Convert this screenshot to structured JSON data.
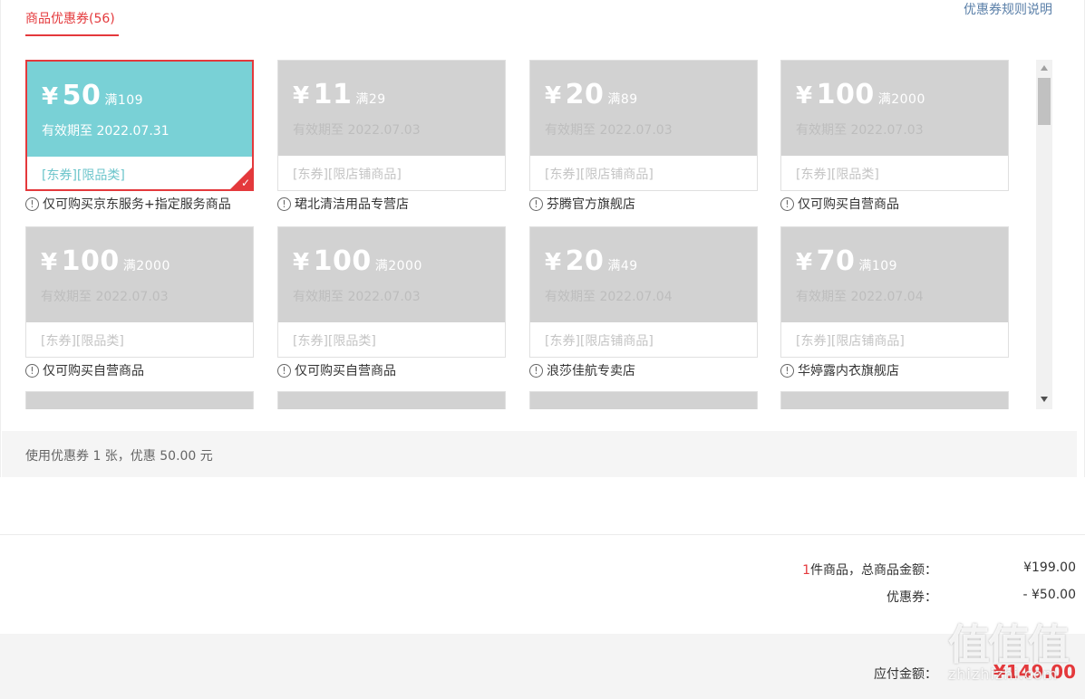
{
  "tab": {
    "label": "商品优惠券(56)"
  },
  "rules_link": "优惠券规则说明",
  "coupons": [
    {
      "currency": "¥",
      "amount": "50",
      "condition": "满109",
      "valid": "有效期至 2022.07.31",
      "tags": "[东券][限品类]",
      "note": "仅可购买京东服务+指定服务商品",
      "selected": true
    },
    {
      "currency": "¥",
      "amount": "11",
      "condition": "满29",
      "valid": "有效期至 2022.07.03",
      "tags": "[东券][限店铺商品]",
      "note": "珺北清洁用品专营店",
      "selected": false
    },
    {
      "currency": "¥",
      "amount": "20",
      "condition": "满89",
      "valid": "有效期至 2022.07.03",
      "tags": "[东券][限店铺商品]",
      "note": "芬腾官方旗舰店",
      "selected": false
    },
    {
      "currency": "¥",
      "amount": "100",
      "condition": "满2000",
      "valid": "有效期至 2022.07.03",
      "tags": "[东券][限品类]",
      "note": "仅可购买自营商品",
      "selected": false
    },
    {
      "currency": "¥",
      "amount": "100",
      "condition": "满2000",
      "valid": "有效期至 2022.07.03",
      "tags": "[东券][限品类]",
      "note": "仅可购买自营商品",
      "selected": false
    },
    {
      "currency": "¥",
      "amount": "100",
      "condition": "满2000",
      "valid": "有效期至 2022.07.03",
      "tags": "[东券][限品类]",
      "note": "仅可购买自营商品",
      "selected": false
    },
    {
      "currency": "¥",
      "amount": "20",
      "condition": "满49",
      "valid": "有效期至 2022.07.04",
      "tags": "[东券][限店铺商品]",
      "note": "浪莎佳航专卖店",
      "selected": false
    },
    {
      "currency": "¥",
      "amount": "70",
      "condition": "满109",
      "valid": "有效期至 2022.07.04",
      "tags": "[东券][限店铺商品]",
      "note": "华婷露内衣旗舰店",
      "selected": false
    }
  ],
  "note_icon": "info-circle-icon",
  "usage_summary": "使用优惠券 1 张，优惠 50.00 元",
  "totals": {
    "count": "1",
    "count_suffix": "件商品，总商品金额：",
    "goods_amount": "¥199.00",
    "coupon_label": "优惠券：",
    "coupon_amount": "- ¥50.00",
    "payable_label": "应付金额：",
    "payable_amount": "¥149.00"
  },
  "watermark": {
    "big": "值值值",
    "small": "zhizhizhi.com"
  },
  "colors": {
    "accent": "#e4393c",
    "active_coupon": "#79d1d6",
    "inactive_coupon": "#d2d2d2"
  }
}
